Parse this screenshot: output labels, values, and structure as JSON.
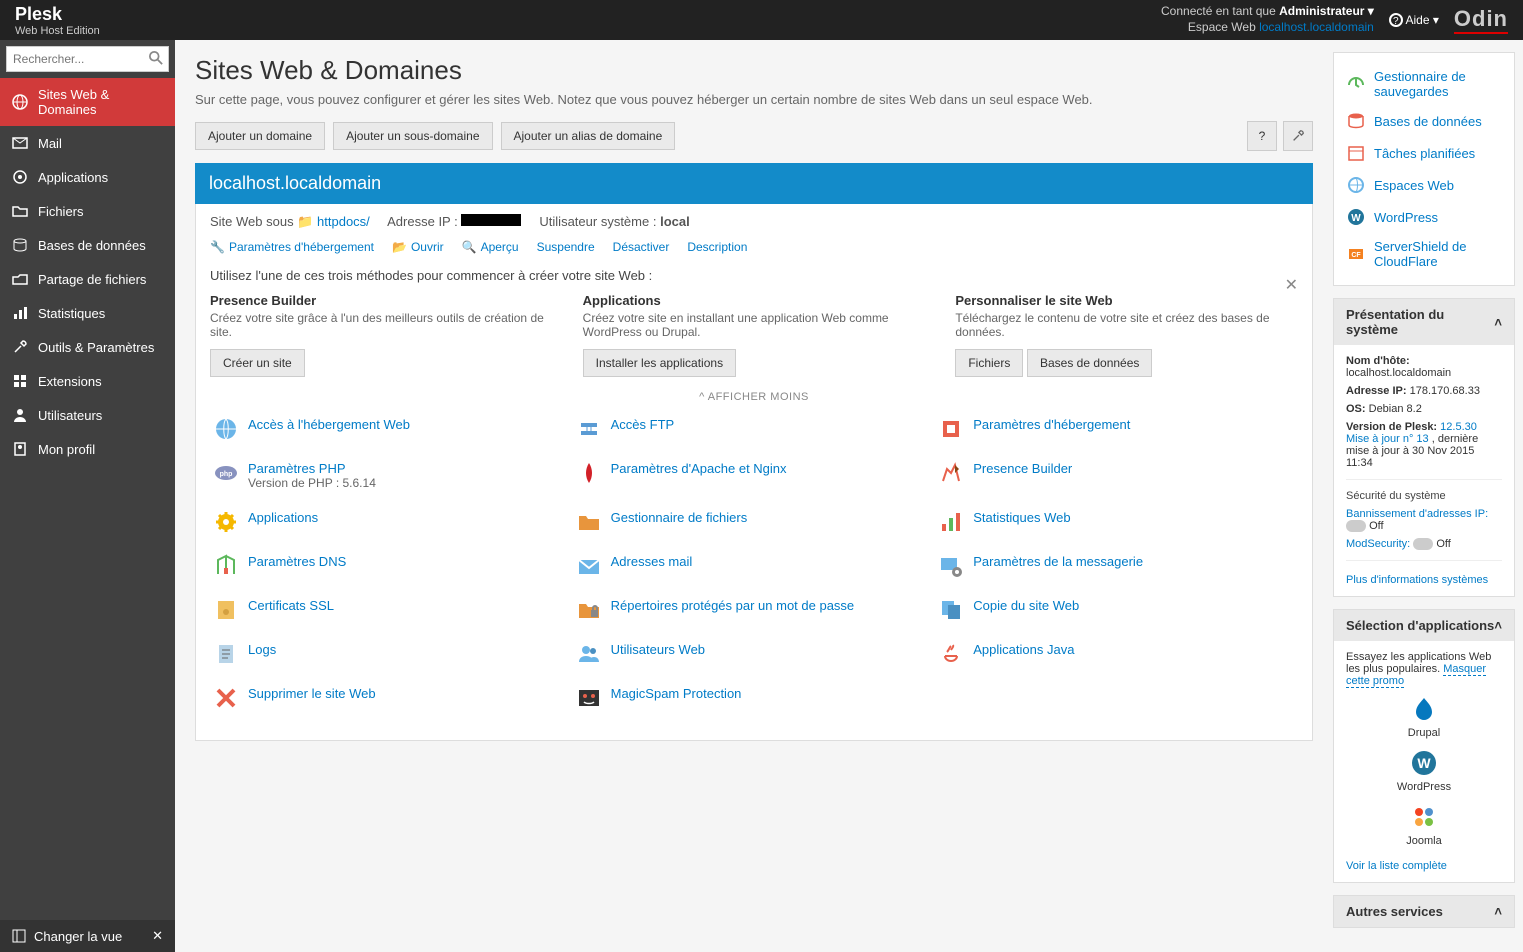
{
  "top": {
    "logo": "Plesk",
    "edition": "Web Host Edition",
    "connected_as": "Connecté en tant que",
    "admin": "Administrateur",
    "webspace_label": "Espace Web",
    "webspace_value": "localhost.localdomain",
    "help": "Aide",
    "brand": "Odin"
  },
  "search": {
    "placeholder": "Rechercher..."
  },
  "nav": [
    {
      "label": "Sites Web & Domaines",
      "icon": "globe",
      "active": true
    },
    {
      "label": "Mail",
      "icon": "mail"
    },
    {
      "label": "Applications",
      "icon": "apps"
    },
    {
      "label": "Fichiers",
      "icon": "folder"
    },
    {
      "label": "Bases de données",
      "icon": "db"
    },
    {
      "label": "Partage de fichiers",
      "icon": "share"
    },
    {
      "label": "Statistiques",
      "icon": "stats"
    },
    {
      "label": "Outils & Paramètres",
      "icon": "tools"
    },
    {
      "label": "Extensions",
      "icon": "ext"
    },
    {
      "label": "Utilisateurs",
      "icon": "user"
    },
    {
      "label": "Mon profil",
      "icon": "profile"
    }
  ],
  "change_view": "Changer la vue",
  "page": {
    "title": "Sites Web & Domaines",
    "subtitle": "Sur cette page, vous pouvez configurer et gérer les sites Web. Notez que vous pouvez héberger un certain nombre de sites Web dans un seul espace Web."
  },
  "actions": {
    "add_domain": "Ajouter un domaine",
    "add_subdomain": "Ajouter un sous-domaine",
    "add_alias": "Ajouter un alias de domaine",
    "help": "?",
    "settings": "🔧"
  },
  "domain": {
    "name": "localhost.localdomain",
    "site_under": "Site Web sous",
    "httpdocs": "httpdocs/",
    "ip_label": "Adresse IP :",
    "user_label": "Utilisateur système :",
    "user_value": "local",
    "hosting_settings": "Paramètres d'hébergement",
    "open": "Ouvrir",
    "preview": "Aperçu",
    "suspend": "Suspendre",
    "disable": "Désactiver",
    "description": "Description"
  },
  "methods": {
    "intro": "Utilisez l'une de ces trois méthodes pour commencer à créer votre site Web :",
    "m1_title": "Presence Builder",
    "m1_desc": "Créez votre site grâce à l'un des meilleurs outils de création de site.",
    "m1_btn": "Créer un site",
    "m2_title": "Applications",
    "m2_desc": "Créez votre site en installant une application Web comme WordPress ou Drupal.",
    "m2_btn": "Installer les applications",
    "m3_title": "Personnaliser le site Web",
    "m3_desc": "Téléchargez le contenu de votre site et créez des bases de données.",
    "m3_btn1": "Fichiers",
    "m3_btn2": "Bases de données",
    "show_less": "AFFICHER MOINS"
  },
  "tools": {
    "web_access": "Accès à l'hébergement Web",
    "ftp": "Accès FTP",
    "hosting": "Paramètres d'hébergement",
    "php": "Paramètres PHP",
    "php_ver": "Version de PHP : 5.6.14",
    "apache": "Paramètres d'Apache et Nginx",
    "pb": "Presence Builder",
    "apps": "Applications",
    "filemgr": "Gestionnaire de fichiers",
    "webstats": "Statistiques Web",
    "dns": "Paramètres DNS",
    "mail": "Adresses mail",
    "msg": "Paramètres de la messagerie",
    "ssl": "Certificats SSL",
    "protected": "Répertoires protégés par un mot de passe",
    "copy": "Copie du site Web",
    "logs": "Logs",
    "webusers": "Utilisateurs Web",
    "java": "Applications Java",
    "remove": "Supprimer le site Web",
    "magicspam": "MagicSpam Protection"
  },
  "quick": [
    "Gestionnaire de sauvegardes",
    "Bases de données",
    "Tâches planifiées",
    "Espaces Web",
    "WordPress",
    "ServerShield de CloudFlare"
  ],
  "system": {
    "title": "Présentation du système",
    "host_l": "Nom d'hôte:",
    "host_v": "localhost.localdomain",
    "ip_l": "Adresse IP:",
    "ip_v": "178.170.68.33",
    "os_l": "OS:",
    "os_v": "Debian 8.2",
    "ver_l": "Version de Plesk:",
    "ver_v": "12.5.30 Mise à jour n° 13",
    "ver_after": ", dernière mise à jour à 30 Nov 2015 11:34",
    "sec_title": "Sécurité du système",
    "ipban": "Bannissement d'adresses IP:",
    "off": "Off",
    "modsec": "ModSecurity:",
    "more": "Plus d'informations systèmes"
  },
  "appsel": {
    "title": "Sélection d'applications",
    "desc": "Essayez les applications Web les plus populaires.",
    "hide": "Masquer cette promo",
    "apps": [
      "Drupal",
      "WordPress",
      "Joomla"
    ],
    "full": "Voir la liste complète"
  },
  "other_services": "Autres services"
}
